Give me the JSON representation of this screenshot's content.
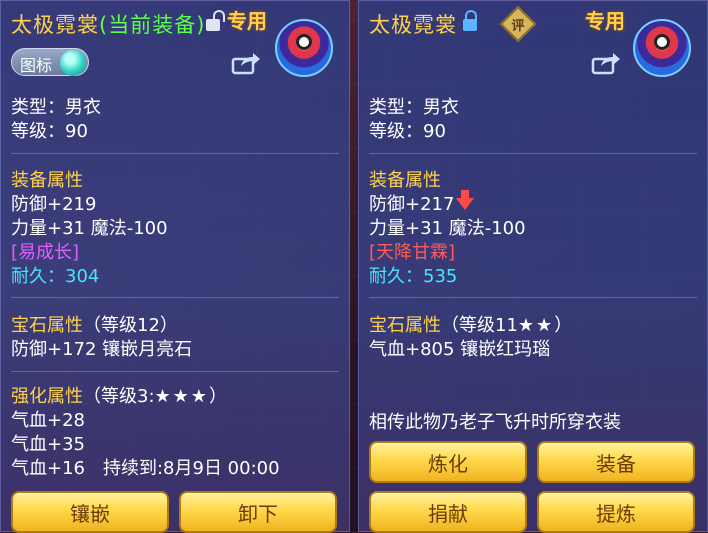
{
  "left": {
    "title_name": "太极霓裳",
    "title_status": "(当前装备)",
    "special": "专用",
    "icon_toggle_label": "图标",
    "type": "类型：男衣",
    "level": "等级：90",
    "equip_header": "装备属性",
    "stats": [
      "防御+219",
      "力量+31 魔法-100"
    ],
    "tag": "[易成长]",
    "durability": "耐久：304",
    "gem_header": "宝石属性",
    "gem_level": "（等级12）",
    "gem_desc": "防御+172 镶嵌月亮石",
    "enhance_header": "强化属性",
    "enhance_level": "（等级3:",
    "enhance_stars": "★★★",
    "enhance_close": "）",
    "enhance_lines": [
      "气血+28",
      "气血+35",
      "气血+16　持续到:8月9日 00:00"
    ],
    "buttons": [
      "镶嵌",
      "卸下"
    ]
  },
  "right": {
    "title_name": "太极霓裳",
    "rating_label": "评",
    "special": "专用",
    "type": "类型：男衣",
    "level": "等级：90",
    "equip_header": "装备属性",
    "stat1": "防御+217",
    "stat2": "力量+31 魔法-100",
    "tag": "[天降甘霖]",
    "durability": "耐久：535",
    "gem_header": "宝石属性",
    "gem_level": "（等级11",
    "gem_stars": "★★",
    "gem_close": "）",
    "gem_desc": "气血+805 镶嵌红玛瑙",
    "lore": "相传此物乃老子飞升时所穿衣装",
    "buttons": [
      "炼化",
      "装备",
      "捐献",
      "提炼"
    ]
  },
  "colors": {
    "gold": "#ffd24a",
    "current_equip_green": "#5cff4a",
    "purple_tag": "#e060ff",
    "red_tag": "#ff5a5a",
    "cyan_durability": "#4ae4ff",
    "button_yellow": "#ffd84a"
  },
  "icons": [
    "lock-open-icon",
    "lock-closed-icon",
    "share-icon",
    "toggle-knob-icon",
    "rating-badge-icon",
    "down-arrow-icon"
  ]
}
